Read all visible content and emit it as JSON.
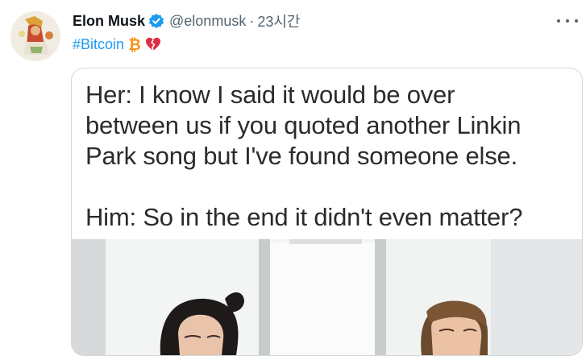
{
  "tweet": {
    "author": {
      "display_name": "Elon Musk",
      "handle": "@elonmusk",
      "verified": true,
      "verified_icon": "verified-badge-icon",
      "avatar": "profile-avatar"
    },
    "separator": "·",
    "timestamp": "23시간",
    "hashtag": "#Bitcoin",
    "emojis": [
      "bitcoin-icon",
      "broken-heart-icon"
    ],
    "more_icon": "more-options-icon",
    "media": {
      "meme_text": "Her: I know I said it would be over\nbetween us if you quoted another Linkin\nPark song but I've found someone else.\n\nHim: So in the end it didn't even matter?",
      "photo": "woman-and-man-photo"
    }
  },
  "colors": {
    "accent": "#1d9bf0",
    "bitcoin": "#f7931a",
    "heart": "#dd2e44",
    "muted_text": "#536471"
  }
}
